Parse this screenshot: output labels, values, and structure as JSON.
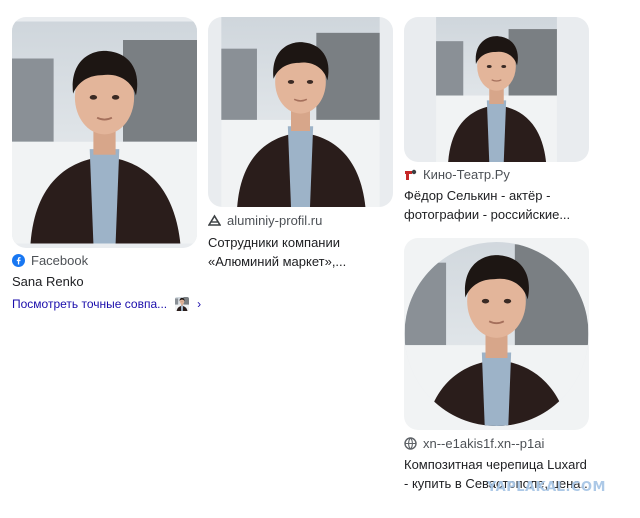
{
  "results": [
    {
      "source": "Facebook",
      "source_icon": "facebook-icon",
      "title_lines": [
        "Sana Renko"
      ],
      "more_link": "Посмотреть точные совпа..."
    },
    {
      "source": "aluminiy-profil.ru",
      "source_icon": "site-logo-icon",
      "title_lines": [
        "Сотрудники компании",
        "«Алюминий маркет»,..."
      ]
    },
    {
      "source": "Кино-Театр.Ру",
      "source_icon": "kinoteatr-icon",
      "title_lines": [
        "Фёдор Селькин - актёр -",
        "фотографии - российские..."
      ]
    },
    {
      "source": "xn--e1akis1f.xn--p1ai",
      "source_icon": "globe-icon",
      "title_lines": [
        "Композитная черепица Luxard",
        "- купить в Севастополе, цена..."
      ]
    }
  ],
  "watermark": "YAPLAKAL.COM",
  "colors": {
    "link": "#1a0dab",
    "source": "#4d5156",
    "title": "#202124",
    "facebook": "#1877f2"
  }
}
